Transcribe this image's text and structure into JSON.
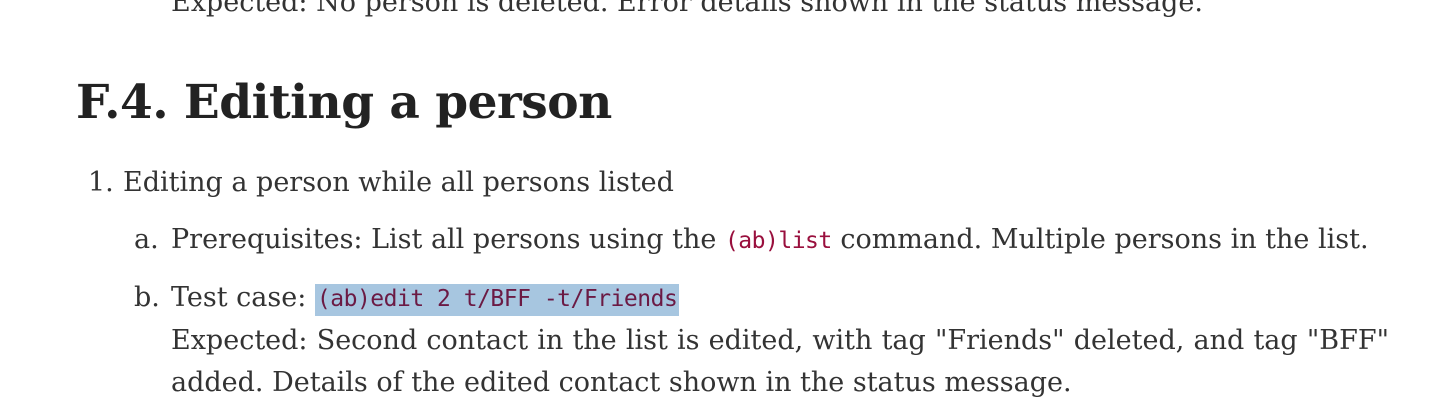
{
  "previous_expected": "Expected: No person is deleted. Error details shown in the status message.",
  "section": {
    "title": "F.4. Editing a person"
  },
  "steps": [
    {
      "number": "1.",
      "text": "Editing a person while all persons listed",
      "substeps": [
        {
          "marker": "a.",
          "prefix": "Prerequisites: List all persons using the ",
          "code": "(ab)list",
          "suffix": " command. Multiple persons in the list."
        },
        {
          "marker": "b.",
          "prefix": "Test case: ",
          "code": "(ab)edit 2 t/BFF -t/Friends",
          "expected": "Expected: Second contact in the list is edited, with tag \"Friends\" deleted, and tag \"BFF\" added. Details of the edited contact shown in the status message."
        }
      ]
    }
  ],
  "colors": {
    "text": "#333333",
    "code": "#990f3d",
    "selection_highlight": "#a7c6e0"
  }
}
